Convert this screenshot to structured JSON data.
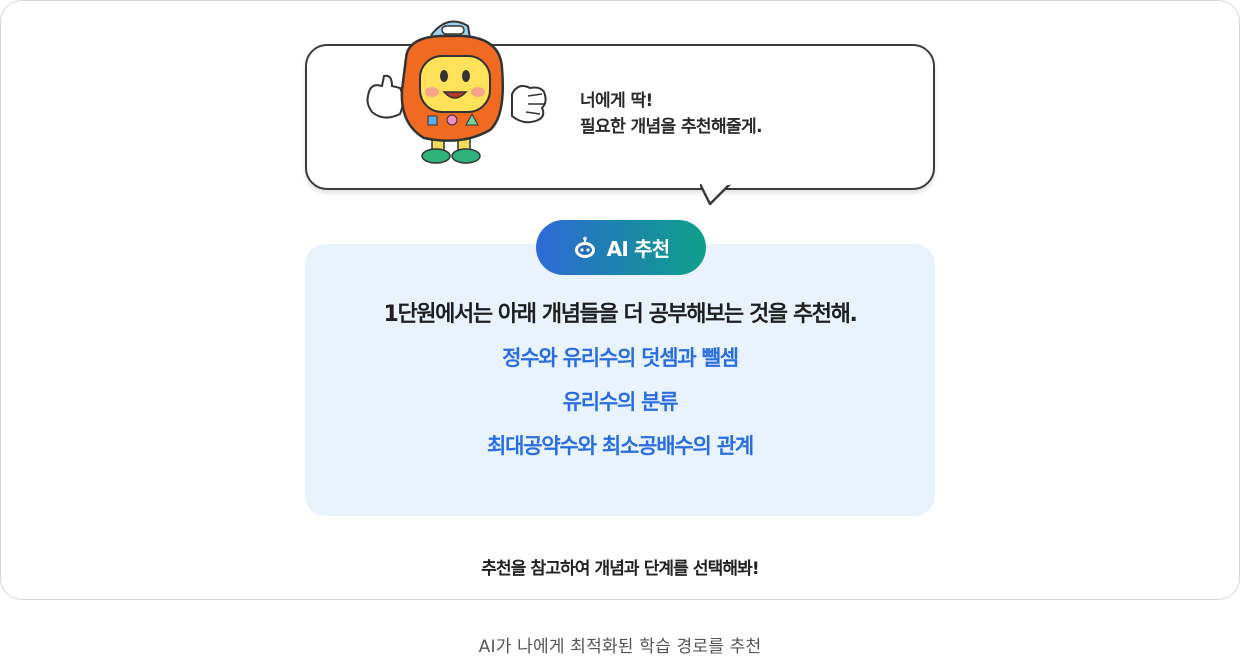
{
  "speech_bubble": {
    "line1": "너에게 딱!",
    "line2": "필요한 개념을 추천해줄게."
  },
  "recommendation": {
    "badge_label": "AI 추천",
    "badge_icon": "robot-icon",
    "lead_text": "1단원에서는 아래 개념들을 더 공부해보는 것을 추천해.",
    "concepts": [
      "정수와 유리수의 덧셈과 뺄셈",
      "유리수의 분류",
      "최대공약수와 최소공배수의 관계"
    ]
  },
  "guide_text": "추천을 참고하여 개념과 단계를 선택해봐!",
  "caption": "AI가 나에게 최적화된 학습 경로를 추천",
  "colors": {
    "concept_blue": "#2a6de0",
    "box_bg": "#e8f3fe",
    "badge_gradient_start": "#2d69d6",
    "badge_gradient_end": "#0fa08d"
  }
}
